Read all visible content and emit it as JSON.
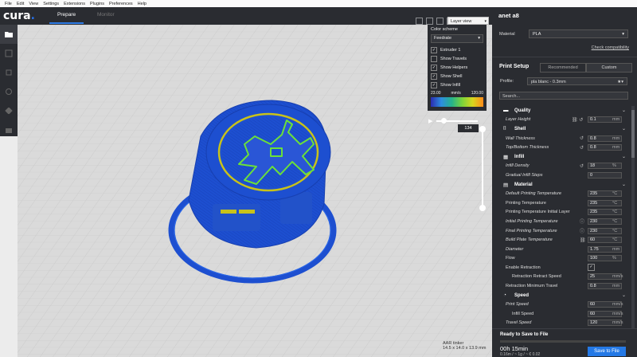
{
  "menu": [
    "File",
    "Edit",
    "View",
    "Settings",
    "Extensions",
    "Plugins",
    "Preferences",
    "Help"
  ],
  "app": {
    "logo_main": "cura",
    "logo_dot": "."
  },
  "tabs": {
    "prepare": "Prepare",
    "monitor": "Monitor"
  },
  "view_select": {
    "value": "Layer view",
    "arrow": "▾"
  },
  "color_panel": {
    "title": "Color scheme",
    "scheme": "Feedrate",
    "options": [
      {
        "label": "Extruder 1",
        "checked": true
      },
      {
        "label": "Show Travels",
        "checked": false
      },
      {
        "label": "Show Helpers",
        "checked": true
      },
      {
        "label": "Show Shell",
        "checked": true
      },
      {
        "label": "Show Infill",
        "checked": true
      }
    ],
    "min": "23.00",
    "unit": "mm/s",
    "max": "120.00"
  },
  "layer": {
    "current": "134"
  },
  "object": {
    "name": "AAR tinker",
    "dims": "14.5 x 14.0 x 13.9 mm"
  },
  "sidebar": {
    "printer": "anet a8",
    "material_label": "Material",
    "material_value": "PLA",
    "check_compat": "Check compatibility",
    "print_setup": "Print Setup",
    "tab_recommended": "Recommended",
    "tab_custom": "Custom",
    "profile_label": "Profile:",
    "profile_value": "pla blanc - 0.3mm",
    "search_placeholder": "Search..."
  },
  "settings": [
    {
      "type": "cat",
      "label": "Quality",
      "icon": "▬"
    },
    {
      "type": "row",
      "label": "Layer Height",
      "italic": true,
      "value": "0.1",
      "unit": "mm",
      "icons": "🔗 ↺"
    },
    {
      "type": "cat",
      "label": "Shell",
      "icon": "⌷"
    },
    {
      "type": "row",
      "label": "Wall Thickness",
      "italic": true,
      "value": "0.8",
      "unit": "mm",
      "icons": "↺"
    },
    {
      "type": "row",
      "label": "Top/Bottom Thickness",
      "italic": true,
      "value": "0.8",
      "unit": "mm",
      "icons": "↺"
    },
    {
      "type": "cat",
      "label": "Infill",
      "icon": "▦"
    },
    {
      "type": "row",
      "label": "Infill Density",
      "italic": true,
      "value": "18",
      "unit": "%",
      "icons": "↺"
    },
    {
      "type": "row",
      "label": "Gradual Infill Steps",
      "italic": true,
      "value": "0",
      "unit": "",
      "icons": ""
    },
    {
      "type": "cat",
      "label": "Material",
      "icon": "▤"
    },
    {
      "type": "row",
      "label": "Default Printing Temperature",
      "italic": true,
      "value": "235",
      "unit": "°C",
      "icons": ""
    },
    {
      "type": "row",
      "label": "Printing Temperature",
      "italic": false,
      "value": "235",
      "unit": "°C",
      "icons": ""
    },
    {
      "type": "row",
      "label": "Printing Temperature Initial Layer",
      "italic": false,
      "value": "235",
      "unit": "°C",
      "icons": ""
    },
    {
      "type": "row",
      "label": "Initial Printing Temperature",
      "italic": true,
      "value": "230",
      "unit": "°C",
      "icons": "ⓘ"
    },
    {
      "type": "row",
      "label": "Final Printing Temperature",
      "italic": true,
      "value": "230",
      "unit": "°C",
      "icons": "ⓘ"
    },
    {
      "type": "row",
      "label": "Build Plate Temperature",
      "italic": true,
      "value": "60",
      "unit": "°C",
      "icons": "🔗"
    },
    {
      "type": "row",
      "label": "Diameter",
      "italic": true,
      "value": "1.75",
      "unit": "mm",
      "icons": ""
    },
    {
      "type": "row",
      "label": "Flow",
      "italic": false,
      "value": "100",
      "unit": "%",
      "icons": ""
    },
    {
      "type": "check",
      "label": "Enable Retraction",
      "italic": false,
      "checked": "✓"
    },
    {
      "type": "row",
      "label": "Retraction Retract Speed",
      "italic": false,
      "indent": true,
      "value": "25",
      "unit": "mm/s",
      "icons": ""
    },
    {
      "type": "row",
      "label": "Retraction Minimum Travel",
      "italic": false,
      "value": "0.8",
      "unit": "mm",
      "icons": ""
    },
    {
      "type": "cat",
      "label": "Speed",
      "icon": "◔"
    },
    {
      "type": "row",
      "label": "Print Speed",
      "italic": true,
      "value": "60",
      "unit": "mm/s",
      "icons": ""
    },
    {
      "type": "row",
      "label": "Infill Speed",
      "italic": false,
      "indent": true,
      "value": "60",
      "unit": "mm/s",
      "icons": ""
    },
    {
      "type": "row",
      "label": "Travel Speed",
      "italic": true,
      "value": "120",
      "unit": "mm/s",
      "icons": ""
    }
  ],
  "ready": {
    "title": "Ready to Save to File",
    "time": "00h 15min",
    "details": "0.16m / ~ 1g / ~ € 0.02",
    "save": "Save to File"
  },
  "colors": {
    "accent": "#2479e6",
    "panel": "#2a2c31",
    "model_blue": "#1d4fd0",
    "model_green": "#6be03a",
    "model_yellow": "#c8c21a"
  }
}
